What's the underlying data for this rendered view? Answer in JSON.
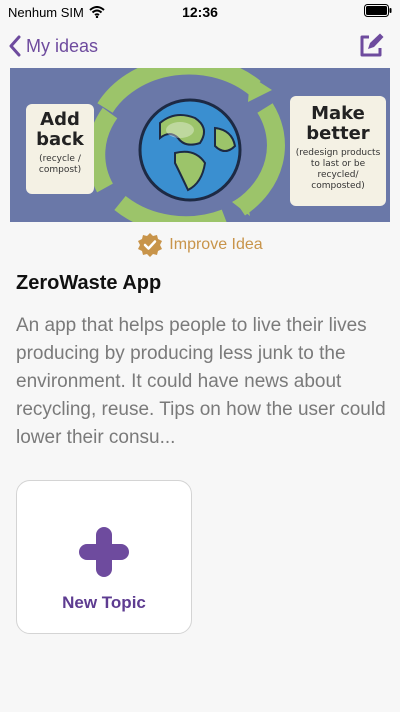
{
  "status_bar": {
    "carrier": "Nenhum SIM",
    "time": "12:36"
  },
  "nav": {
    "back_label": "My ideas"
  },
  "hero": {
    "left_card": {
      "title_line1": "Add",
      "title_line2": "back",
      "note": "(recycle / compost)"
    },
    "right_card": {
      "title_line1": "Make",
      "title_line2": "better",
      "note": "(redesign products to last or be recycled/ composted)"
    }
  },
  "improve_label": "Improve Idea",
  "idea": {
    "title": "ZeroWaste App",
    "description": "An app that helps people to live their lives producing by producing less junk to the environment. It could have news about recycling, reuse. Tips on how the user could lower their consu..."
  },
  "new_topic_label": "New Topic",
  "colors": {
    "accent": "#6e4b9e",
    "improve": "#c8944a",
    "hero_bg": "#6a78a8",
    "text_muted": "#7a7a7a"
  }
}
